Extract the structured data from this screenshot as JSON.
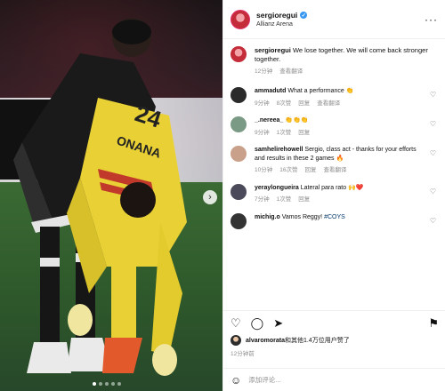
{
  "post": {
    "username": "sergioregui",
    "location": "Allianz Arena",
    "caption_user": "sergioregui",
    "caption_text": "We lose together. We will come back stronger together.",
    "caption_time": "12分钟",
    "translate": "查看翻译"
  },
  "comments": [
    {
      "user": "ammadutd",
      "text": "What a performance 👏",
      "time": "9分钟",
      "likes": "8次赞",
      "reply": "回复",
      "translate": "查看翻译",
      "avatar_color": "#2b2b2b"
    },
    {
      "user": "_.nereea_",
      "text": "👏👏👏",
      "time": "9分钟",
      "likes": "1次赞",
      "reply": "回复",
      "translate": "",
      "avatar_color": "#7a9a86"
    },
    {
      "user": "samhelirehowell",
      "text": "Sergio, class act - thanks for your efforts and results in these 2 games 🔥",
      "time": "10分钟",
      "likes": "16次赞",
      "reply": "回复",
      "translate": "查看翻译",
      "avatar_color": "#c9a08a"
    },
    {
      "user": "yeraylongueira",
      "text": "Lateral para rato 🙌❤️",
      "time": "7分钟",
      "likes": "1次赞",
      "reply": "回复",
      "translate": "",
      "avatar_color": "#4a4a5a"
    },
    {
      "user": "michig.o",
      "text": "Vamos Reggy! ",
      "tag": "#COYS",
      "time": "",
      "likes": "",
      "reply": "",
      "translate": "",
      "avatar_color": "#333333"
    }
  ],
  "liked_by": {
    "user": "alvaromorata",
    "rest": "和其他1.4万位用户赞了"
  },
  "post_time": "12分钟前",
  "add_comment_placeholder": "添加评论...",
  "photo": {
    "jersey_name": "ONANA",
    "jersey_number": "24",
    "carousel_next": "›"
  }
}
